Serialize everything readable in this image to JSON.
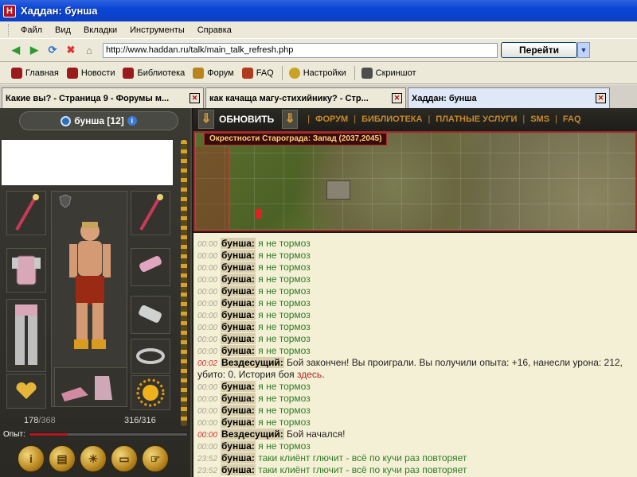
{
  "window": {
    "title": "Хаддан: бунша"
  },
  "menu": [
    "Файл",
    "Вид",
    "Вкладки",
    "Инструменты",
    "Справка"
  ],
  "nav": {
    "url": "http://www.haddan.ru/talk/main_talk_refresh.php",
    "go_label": "Перейти"
  },
  "bookmarks": [
    {
      "label": "Главная",
      "icon": "haddan-icon"
    },
    {
      "label": "Новости",
      "icon": "haddan-icon"
    },
    {
      "label": "Библиотека",
      "icon": "haddan-icon"
    },
    {
      "label": "Форум",
      "icon": "forum-icon"
    },
    {
      "label": "FAQ",
      "icon": "faq-icon"
    },
    {
      "label": "Настройки",
      "icon": "settings-icon"
    },
    {
      "label": "Скриншот",
      "icon": "camera-icon"
    }
  ],
  "tabs": [
    {
      "label": "Какие вы? - Страница 9 - Форумы м...",
      "active": false
    },
    {
      "label": "как качаща магу-стихийнику? - Стр...",
      "active": false
    },
    {
      "label": "Хаддан: бунша",
      "active": true
    }
  ],
  "character": {
    "name": "бунша [12]",
    "hp": "178",
    "hp_max": "/368",
    "mp": "316",
    "mp_max": "/316",
    "exp_label": "Опыт:",
    "exp_fraction": 0.24
  },
  "game_nav": {
    "refresh_label": "ОБНОВИТЬ",
    "links": [
      "ФОРУМ",
      "БИБЛИОТЕКА",
      "ПЛАТНЫЕ УСЛУГИ",
      "SMS",
      "FAQ"
    ]
  },
  "map": {
    "caption": "Окрестности Старограда: Запад (2037,2045)"
  },
  "chat": [
    {
      "time": "00:00",
      "nick": "бунша:",
      "text": "я не тормоз"
    },
    {
      "time": "00:00",
      "nick": "бунша:",
      "text": "я не тормоз"
    },
    {
      "time": "00:00",
      "nick": "бунша:",
      "text": "я не тормоз"
    },
    {
      "time": "00:00",
      "nick": "бунша:",
      "text": "я не тормоз"
    },
    {
      "time": "00:00",
      "nick": "бунша:",
      "text": "я не тормоз"
    },
    {
      "time": "00:00",
      "nick": "бунша:",
      "text": "я не тормоз"
    },
    {
      "time": "00:00",
      "nick": "бунша:",
      "text": "я не тормоз"
    },
    {
      "time": "00:00",
      "nick": "бунша:",
      "text": "я не тормоз"
    },
    {
      "time": "00:00",
      "nick": "бунша:",
      "text": "я не тормоз"
    },
    {
      "time": "00:00",
      "nick": "бунша:",
      "text": "я не тормоз"
    },
    {
      "time": "00:02",
      "nick": "Вездесущий:",
      "text": "Бой закончен! Вы проиграли. Вы получили опыта: +16, нанесли урона: 212,",
      "system": true,
      "time_red": true
    },
    {
      "time": "",
      "nick": "",
      "text": "убито: 0. История боя ",
      "link": "здесь",
      "tail": ".",
      "system": true,
      "continuation": true
    },
    {
      "time": "00:00",
      "nick": "бунша:",
      "text": "я не тормоз"
    },
    {
      "time": "00:00",
      "nick": "бунша:",
      "text": "я не тормоз"
    },
    {
      "time": "00:00",
      "nick": "бунша:",
      "text": "я не тормоз"
    },
    {
      "time": "00:00",
      "nick": "бунша:",
      "text": "я не тормоз"
    },
    {
      "time": "00:00",
      "nick": "Вездесущий:",
      "text": "Бой начался!",
      "system": true,
      "time_red": true
    },
    {
      "time": "00:00",
      "nick": "бунша:",
      "text": "я не тормоз"
    },
    {
      "time": "23:52",
      "nick": "бунша:",
      "text": "таки клиёнт глючит - всё по кучи раз повторяет"
    },
    {
      "time": "23:52",
      "nick": "бунша:",
      "text": "таки клиёнт глючит - всё по кучи раз повторяет"
    }
  ]
}
